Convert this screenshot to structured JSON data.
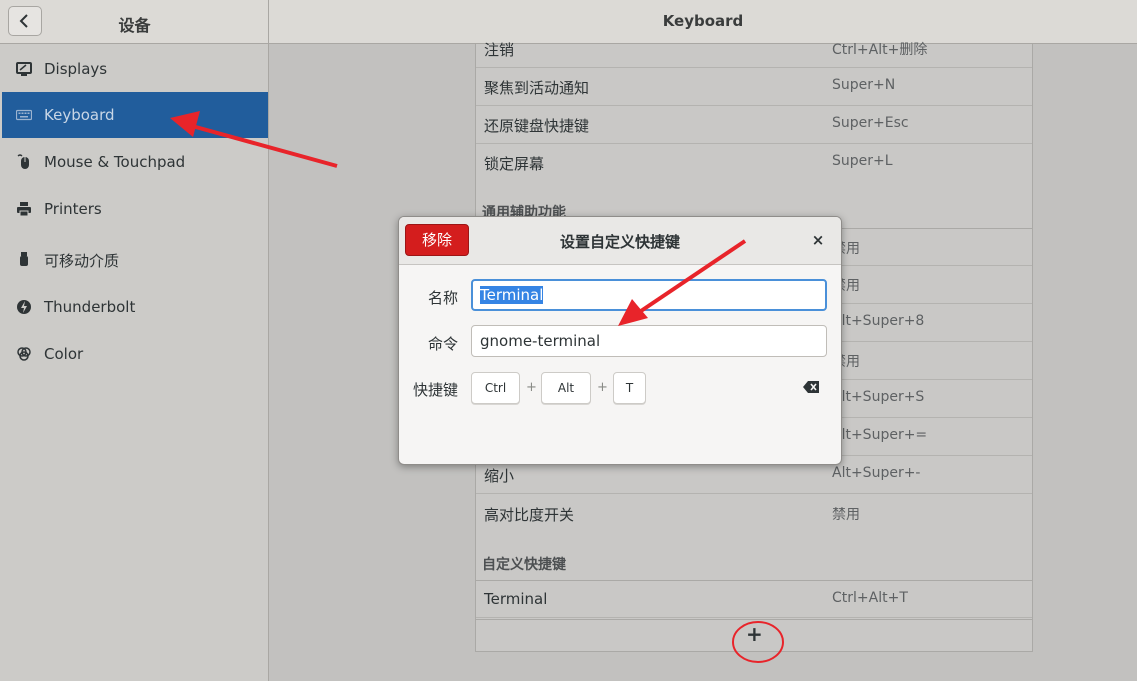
{
  "header": {
    "left_title": "设备",
    "title": "Keyboard"
  },
  "sidebar": {
    "items": [
      {
        "label": "Displays",
        "icon": "display-icon"
      },
      {
        "label": "Keyboard",
        "icon": "keyboard-icon",
        "active": true
      },
      {
        "label": "Mouse & Touchpad",
        "icon": "mouse-icon"
      },
      {
        "label": "Printers",
        "icon": "printer-icon"
      },
      {
        "label": "可移动介质",
        "icon": "removable-media-icon"
      },
      {
        "label": "Thunderbolt",
        "icon": "thunderbolt-icon"
      },
      {
        "label": "Color",
        "icon": "color-icon"
      }
    ]
  },
  "shortcuts": {
    "rows_top": [
      {
        "name": "注销",
        "shortcut": "Ctrl+Alt+删除"
      },
      {
        "name": "聚焦到活动通知",
        "shortcut": "Super+N"
      },
      {
        "name": "还原键盘快捷键",
        "shortcut": "Super+Esc"
      },
      {
        "name": "锁定屏幕",
        "shortcut": "Super+L"
      }
    ],
    "section_accessibility": "通用辅助功能",
    "rows_access_visible_shortcuts": [
      "禁用",
      "禁用",
      "Alt+Super+8",
      "禁用",
      "Alt+Super+S",
      "Alt+Super+="
    ],
    "rows_bottom": [
      {
        "name": "缩小",
        "shortcut": "Alt+Super+-"
      },
      {
        "name": "高对比度开关",
        "shortcut": "禁用"
      }
    ],
    "section_custom": "自定义快捷键",
    "custom_rows": [
      {
        "name": "Terminal",
        "shortcut": "Ctrl+Alt+T"
      }
    ],
    "add_label": "+"
  },
  "dialog": {
    "remove_label": "移除",
    "title": "设置自定义快捷键",
    "close_label": "×",
    "name_label": "名称",
    "name_value": "Terminal",
    "command_label": "命令",
    "command_value": "gnome-terminal",
    "shortcut_label": "快捷键",
    "keys": [
      "Ctrl",
      "Alt",
      "T"
    ],
    "key_separator": "+"
  },
  "colors": {
    "accent": "#215d9c",
    "destructive": "#d41d1d",
    "annotation": "#e8242a",
    "focus": "#4a90d9"
  }
}
